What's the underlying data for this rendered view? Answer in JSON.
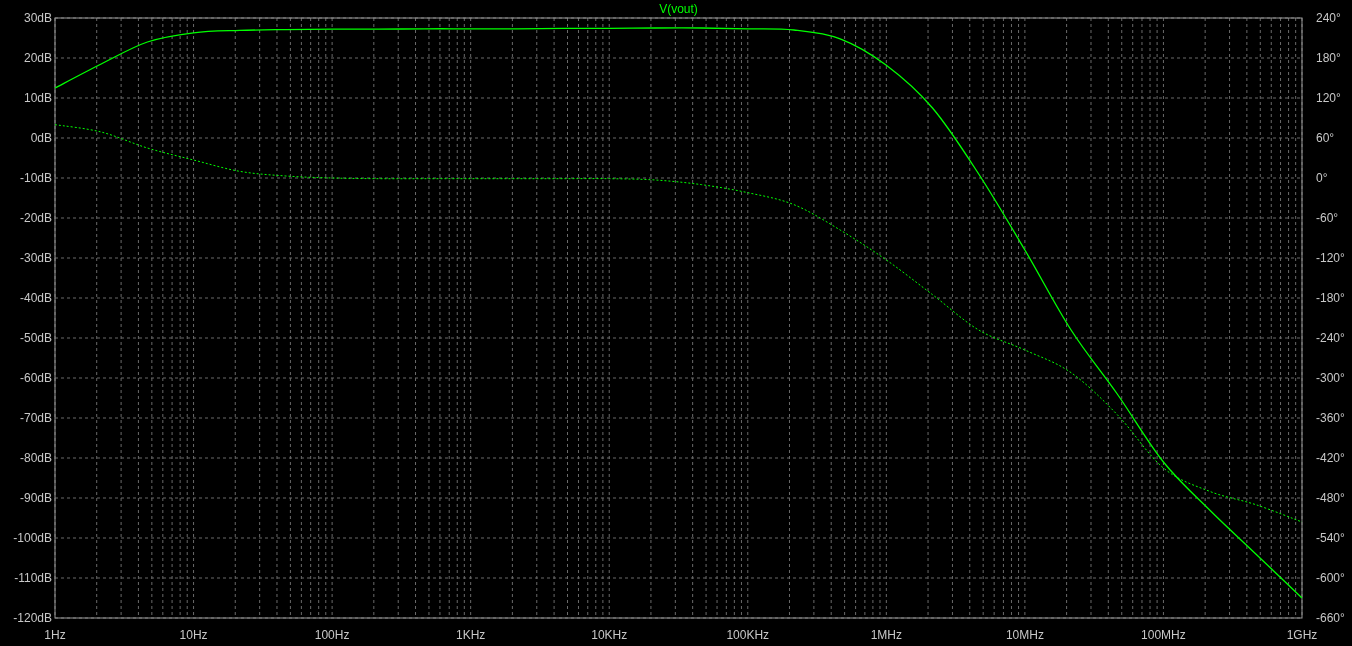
{
  "plot": {
    "chart_data": {
      "type": "line",
      "grid": true,
      "ylim": [
        -120,
        30
      ],
      "y2lim": [
        -660,
        240
      ],
      "categories": [
        "1Hz",
        null,
        null,
        "10Hz",
        null,
        null,
        "100Hz",
        null,
        null,
        "1KHz",
        null,
        null,
        "10KHz",
        null,
        null,
        "100KHz",
        null,
        null,
        "1MHz",
        null,
        null,
        "10MHz",
        null,
        null,
        "100MHz",
        null,
        null,
        "1GHz"
      ],
      "yticks": [
        {
          "value": 30,
          "label": "30dB"
        },
        {
          "value": 20,
          "label": "20dB"
        },
        {
          "value": 10,
          "label": "10dB"
        },
        {
          "value": 0,
          "label": "0dB"
        },
        {
          "value": -10,
          "label": "-10dB"
        },
        {
          "value": -20,
          "label": "-20dB"
        },
        {
          "value": -30,
          "label": "-30dB"
        },
        {
          "value": -40,
          "label": "-40dB"
        },
        {
          "value": -50,
          "label": "-50dB"
        },
        {
          "value": -60,
          "label": "-60dB"
        },
        {
          "value": -70,
          "label": "-70dB"
        },
        {
          "value": -80,
          "label": "-80dB"
        },
        {
          "value": -90,
          "label": "-90dB"
        },
        {
          "value": -100,
          "label": "-100dB"
        },
        {
          "value": -110,
          "label": "-110dB"
        },
        {
          "value": -120,
          "label": "-120dB"
        }
      ],
      "y2ticks": [
        {
          "value": 240,
          "label": "240°"
        },
        {
          "value": 180,
          "label": "180°"
        },
        {
          "value": 120,
          "label": "120°"
        },
        {
          "value": 60,
          "label": "60°"
        },
        {
          "value": 0,
          "label": "0°"
        },
        {
          "value": -60,
          "label": "-60°"
        },
        {
          "value": -120,
          "label": "-120°"
        },
        {
          "value": -180,
          "label": "-180°"
        },
        {
          "value": -240,
          "label": "-240°"
        },
        {
          "value": -300,
          "label": "-300°"
        },
        {
          "value": -360,
          "label": "-360°"
        },
        {
          "value": -420,
          "label": "-420°"
        },
        {
          "value": -480,
          "label": "-480°"
        },
        {
          "value": -540,
          "label": "-540°"
        },
        {
          "value": -600,
          "label": "-600°"
        },
        {
          "value": -660,
          "label": "-660°"
        }
      ],
      "series": [
        {
          "name": "V(vout)",
          "color": "#00ff00",
          "values": [
            12.5,
            18.5,
            24,
            26.3,
            26.9,
            27.1,
            27.2,
            27.2,
            27.3,
            27.3,
            27.3,
            27.4,
            27.4,
            27.5,
            27.5,
            27.3,
            27,
            24.8,
            18.2,
            7.5,
            -9,
            -28,
            -48,
            -64,
            -81,
            -93,
            -104,
            -115
          ]
        },
        {
          "axis": "y2",
          "line_style": "dotted",
          "color": "#00ff00",
          "values": [
            80,
            69,
            45,
            27,
            10,
            3,
            0,
            -1,
            -1,
            -1,
            -1,
            -1,
            -1,
            -3,
            -10,
            -22,
            -40,
            -78,
            -123,
            -175,
            -228,
            -258,
            -292,
            -355,
            -435,
            -470,
            -490,
            -516
          ]
        }
      ]
    }
  }
}
